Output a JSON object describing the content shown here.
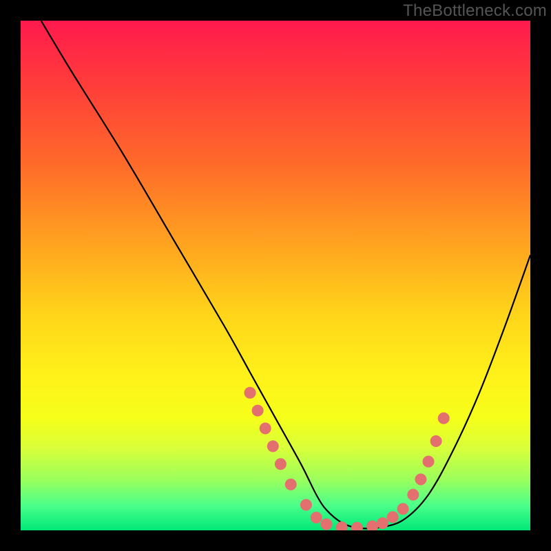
{
  "watermark": "TheBottleneck.com",
  "chart_data": {
    "type": "line",
    "title": "",
    "xlabel": "",
    "ylabel": "",
    "xlim": [
      0,
      100
    ],
    "ylim": [
      0,
      100
    ],
    "series": [
      {
        "name": "curve",
        "x": [
          4,
          10,
          20,
          30,
          40,
          45,
          50,
          55,
          58,
          60,
          63,
          66,
          70,
          75,
          80,
          85,
          90,
          95,
          100
        ],
        "y": [
          100,
          90,
          74,
          57,
          40,
          31,
          22,
          13,
          7,
          4,
          1.5,
          0.5,
          0.5,
          2,
          7,
          16,
          27,
          40,
          54
        ]
      }
    ],
    "markers": [
      {
        "x": 45.0,
        "y": 27.0
      },
      {
        "x": 46.5,
        "y": 23.5
      },
      {
        "x": 48.0,
        "y": 20.0
      },
      {
        "x": 49.5,
        "y": 16.5
      },
      {
        "x": 51.0,
        "y": 13.0
      },
      {
        "x": 53.0,
        "y": 9.0
      },
      {
        "x": 56.0,
        "y": 5.0
      },
      {
        "x": 58.0,
        "y": 2.5
      },
      {
        "x": 60.0,
        "y": 1.2
      },
      {
        "x": 63.0,
        "y": 0.6
      },
      {
        "x": 66.0,
        "y": 0.5
      },
      {
        "x": 69.0,
        "y": 0.8
      },
      {
        "x": 71.0,
        "y": 1.4
      },
      {
        "x": 73.0,
        "y": 2.6
      },
      {
        "x": 75.0,
        "y": 4.2
      },
      {
        "x": 77.0,
        "y": 7.0
      },
      {
        "x": 78.5,
        "y": 10.0
      },
      {
        "x": 80.0,
        "y": 13.5
      },
      {
        "x": 81.5,
        "y": 17.5
      },
      {
        "x": 83.0,
        "y": 22.0
      }
    ],
    "colors": {
      "curve": "#000000",
      "marker_fill": "#e36f6f",
      "marker_stroke": "#e36f6f"
    }
  }
}
